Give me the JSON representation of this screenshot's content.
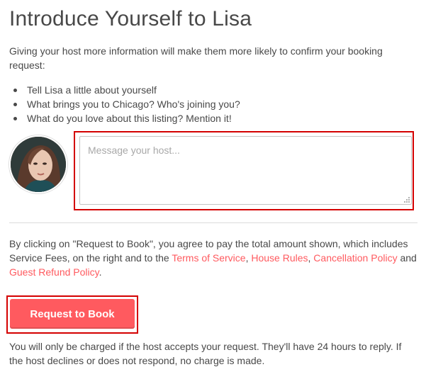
{
  "heading": "Introduce Yourself to Lisa",
  "intro": "Giving your host more information will make them more likely to confirm your booking request:",
  "tips": [
    "Tell Lisa a little about yourself",
    "What brings you to Chicago? Who's joining you?",
    "What do you love about this listing? Mention it!"
  ],
  "message": {
    "placeholder": "Message your host...",
    "value": ""
  },
  "terms": {
    "prefix": "By clicking on \"Request to Book\", you agree to pay the total amount shown, which includes Service Fees, on the right and to the ",
    "terms_of_service": "Terms of Service",
    "sep1": ", ",
    "house_rules": "House Rules",
    "sep2": ", ",
    "cancellation_policy": "Cancellation Policy",
    "and": " and ",
    "guest_refund_policy": "Guest Refund Policy",
    "end": "."
  },
  "book_button_label": "Request to Book",
  "charge_note": "You will only be charged if the host accepts your request. They'll have 24 hours to reply. If the host declines or does not respond, no charge is made.",
  "colors": {
    "brand": "#ff5a5f",
    "text": "#484848",
    "highlight": "#d40000"
  }
}
